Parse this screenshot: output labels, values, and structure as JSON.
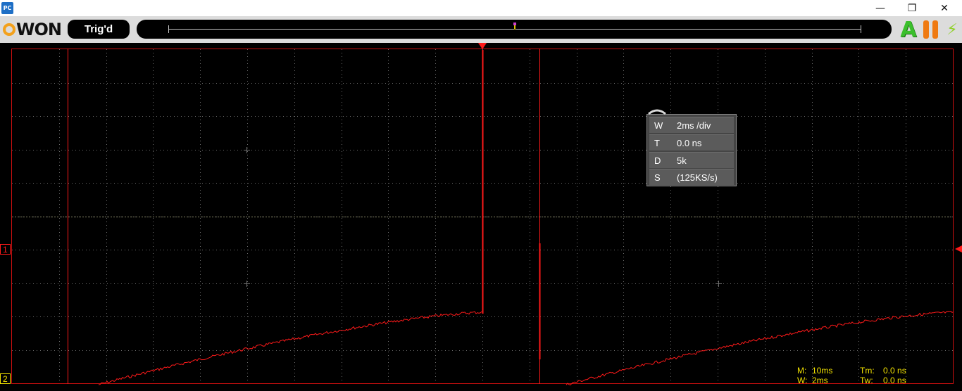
{
  "window": {
    "app_icon_label": "PC",
    "minimize_glyph": "—",
    "restore_glyph": "❐",
    "close_glyph": "✕"
  },
  "toolbar": {
    "logo_text": "WON",
    "trigger_status": "Trig'd",
    "auto_label": "A",
    "power_glyph": "⚡",
    "icons": [
      "owon-logo",
      "auto-icon",
      "pause-icon",
      "power-icon"
    ]
  },
  "timebase_bar": {
    "position_marker_percent": 50
  },
  "screen": {
    "channel1_label": "1",
    "channel2_label": "2",
    "colors": {
      "grid": "#6e6e6e",
      "channel1": "#ff1a1a",
      "channel2": "#f0e000",
      "background": "#000000"
    }
  },
  "settings_panel": {
    "rows": [
      {
        "key": "W",
        "value": "2ms /div"
      },
      {
        "key": "T",
        "value": "0.0 ns"
      },
      {
        "key": "D",
        "value": "5k"
      },
      {
        "key": "S",
        "value": "(125KS/s)"
      }
    ]
  },
  "status": {
    "m_label": "M:",
    "m_value": "10ms",
    "w_label": "W:",
    "w_value": "2ms",
    "tm_label": "Tm:",
    "tm_value": "0.0 ns",
    "tw_label": "Tw:",
    "tw_value": "0.0 ns"
  }
}
